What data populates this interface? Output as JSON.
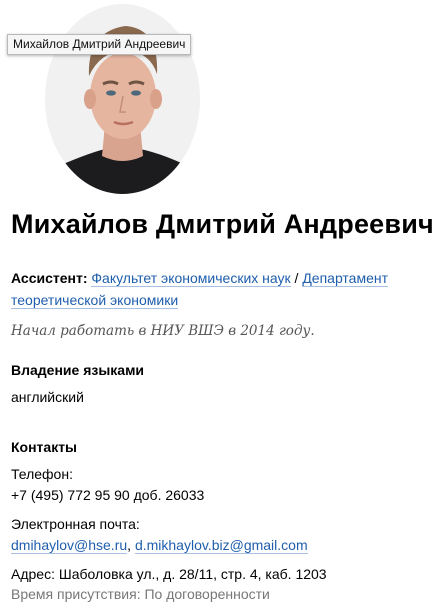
{
  "tooltip": "Михайлов Дмитрий Андреевич",
  "profile": {
    "name": "Михайлов Дмитрий Андреевич",
    "role": "Ассистент:",
    "faculty_link": "Факультет экономических наук",
    "separator": " / ",
    "department_link": "Департамент теоретической экономики",
    "start_note": "Начал работать в НИУ ВШЭ в 2014 году."
  },
  "languages": {
    "heading": "Владение языками",
    "value": "английский"
  },
  "contacts": {
    "heading": "Контакты",
    "phone_label": "Телефон:",
    "phone_value": "+7 (495) 772 95 90 доб. 26033",
    "email_label": "Электронная почта:",
    "email_1": "dmihaylov@hse.ru",
    "email_sep": ", ",
    "email_2": "d.mikhaylov.biz@gmail.com",
    "address": "Адрес: Шаболовка ул., д. 28/11, стр. 4, каб. 1203",
    "presence": "Время присутствия: По договоренности"
  },
  "colors": {
    "link": "#1f5eac",
    "muted": "#777777"
  }
}
